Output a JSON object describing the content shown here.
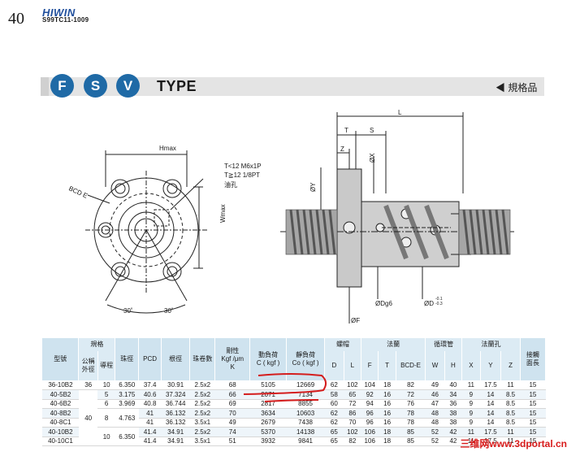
{
  "header": {
    "page_number": "40",
    "brand": "HIWIN",
    "doc_code": "S99TC11-1009"
  },
  "type_header": {
    "letters": [
      "F",
      "S",
      "V"
    ],
    "title": "TYPE",
    "spec_link": "◀ 規格品"
  },
  "diagram": {
    "hmax": "Hmax",
    "bcd_e": "BCD E",
    "oil_hole_line1": "T<12  M6x1P",
    "oil_hole_line2": "T≧12  1/8PT",
    "oil_hole_line3": "油孔",
    "wmax": "Wmax",
    "angle_left": "30˚",
    "angle_right": "30˚",
    "L": "L",
    "T": "T",
    "S": "S",
    "Z": "Z",
    "X": "ØX",
    "Y": "ØY",
    "Dg6": "ØDg6",
    "F": "ØF",
    "D": "ØD",
    "D_tol_top": "-0.1",
    "D_tol_bottom": "-0.3"
  },
  "table": {
    "headers": {
      "model": "型號",
      "spec": "規格",
      "nominal_od": "公稱\n外徑",
      "lead": "導程",
      "ball_dia": "珠徑",
      "pcd": "PCD",
      "root_dia": "根徑",
      "circuits": "珠卷數",
      "stiffness": "剛性\nKgf /μm\nK",
      "dynamic": "動負荷\nC ( kgf )",
      "static": "靜負荷\nCo ( kgf )",
      "nut": "螺帽",
      "flange": "法蘭",
      "return_tube": "循環管",
      "flange_hole": "法蘭孔",
      "wiper": "接觸\n面長",
      "D": "D",
      "L": "L",
      "F": "F",
      "T": "T",
      "BCD_E": "BCD-E",
      "W": "W",
      "H": "H",
      "X": "X",
      "Y": "Y",
      "Z": "Z",
      "S": "S"
    },
    "rows": [
      {
        "model": "36-10B2",
        "od": "36",
        "lead": "10",
        "ball": "6.350",
        "pcd": "37.4",
        "root": "30.91",
        "circ": "2.5x2",
        "k": "68",
        "c": "5105",
        "co": "12669",
        "D": "62",
        "L": "102",
        "F": "104",
        "T": "18",
        "E": "82",
        "W": "49",
        "H": "40",
        "X": "11",
        "Y": "17.5",
        "Z": "11",
        "S": "15"
      },
      {
        "model": "40-5B2",
        "od": "",
        "lead": "5",
        "ball": "3.175",
        "pcd": "40.6",
        "root": "37.324",
        "circ": "2.5x2",
        "k": "66",
        "c": "2071",
        "co": "7134",
        "D": "58",
        "L": "65",
        "F": "92",
        "T": "16",
        "E": "72",
        "W": "46",
        "H": "34",
        "X": "9",
        "Y": "14",
        "Z": "8.5",
        "S": "15"
      },
      {
        "model": "40-6B2",
        "od": "",
        "lead": "6",
        "ball": "3.969",
        "pcd": "40.8",
        "root": "36.744",
        "circ": "2.5x2",
        "k": "69",
        "c": "2817",
        "co": "8855",
        "D": "60",
        "L": "72",
        "F": "94",
        "T": "16",
        "E": "76",
        "W": "47",
        "H": "36",
        "X": "9",
        "Y": "14",
        "Z": "8.5",
        "S": "15"
      },
      {
        "model": "40-8B2",
        "od": "",
        "lead": "",
        "ball": "",
        "pcd": "41",
        "root": "36.132",
        "circ": "2.5x2",
        "k": "70",
        "c": "3634",
        "co": "10603",
        "D": "62",
        "L": "86",
        "F": "96",
        "T": "16",
        "E": "78",
        "W": "48",
        "H": "38",
        "X": "9",
        "Y": "14",
        "Z": "8.5",
        "S": "15"
      },
      {
        "model": "40-8C1",
        "od": "",
        "lead": "",
        "ball": "",
        "pcd": "41",
        "root": "36.132",
        "circ": "3.5x1",
        "k": "49",
        "c": "2679",
        "co": "7438",
        "D": "62",
        "L": "70",
        "F": "96",
        "T": "16",
        "E": "78",
        "W": "48",
        "H": "38",
        "X": "9",
        "Y": "14",
        "Z": "8.5",
        "S": "15"
      },
      {
        "model": "40-10B2",
        "od": "",
        "lead": "",
        "ball": "",
        "pcd": "41.4",
        "root": "34.91",
        "circ": "2.5x2",
        "k": "74",
        "c": "5370",
        "co": "14138",
        "D": "65",
        "L": "102",
        "F": "106",
        "T": "18",
        "E": "85",
        "W": "52",
        "H": "42",
        "X": "11",
        "Y": "17.5",
        "Z": "11",
        "S": "15"
      },
      {
        "model": "40-10C1",
        "od": "",
        "lead": "",
        "ball": "",
        "pcd": "41.4",
        "root": "34.91",
        "circ": "3.5x1",
        "k": "51",
        "c": "3932",
        "co": "9841",
        "D": "65",
        "L": "82",
        "F": "106",
        "T": "18",
        "E": "85",
        "W": "52",
        "H": "42",
        "X": "11",
        "Y": "17.5",
        "Z": "11",
        "S": "15"
      }
    ],
    "merged": {
      "od_40": "40",
      "lead_8": "8",
      "ball_8": "4.763",
      "lead_10": "10",
      "ball_10": "6.350"
    }
  },
  "watermark": "三维网www.3dportal.cn"
}
